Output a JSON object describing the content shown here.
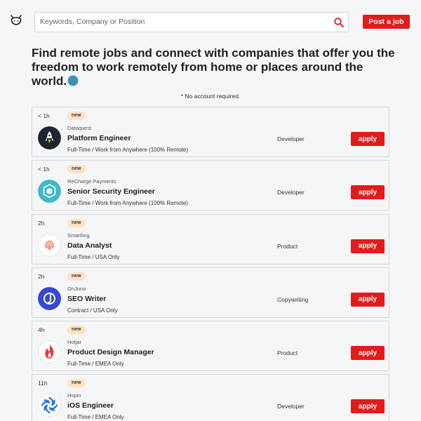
{
  "header": {
    "logo_icon": "cat-logo-icon",
    "search": {
      "placeholder": "Keywords, Company or Position",
      "icon": "search-icon"
    },
    "post_job_label": "Post a job"
  },
  "hero": {
    "headline": "Find remote jobs and connect with companies that offer you the freedom to work remotely from home or places around the world.",
    "globe_icon": "globe-icon",
    "note": "* No account required."
  },
  "colors": {
    "accent": "#e21b1b",
    "badge_bg": "#fbe3c2"
  },
  "jobs": [
    {
      "age": "< 1h",
      "badge": "new",
      "company": "Dataquest",
      "title": "Platform Engineer",
      "type": "Full-Time / Work from Anywhere (100% Remote)",
      "category": "Developer",
      "apply": "apply",
      "logo": "rocket-logo-icon"
    },
    {
      "age": "< 1h",
      "badge": "new",
      "company": "ReCharge Payments",
      "title": "Senior Security Engineer",
      "type": "Full-Time / Work from Anywhere (100% Remote)",
      "category": "Developer",
      "apply": "apply",
      "logo": "recharge-logo-icon"
    },
    {
      "age": "2h",
      "badge": "new",
      "company": "Smartling",
      "title": "Data Analyst",
      "type": "Full-Time / USA Only",
      "category": "Product",
      "apply": "apply",
      "logo": "fingerprint-logo-icon"
    },
    {
      "age": "2h",
      "badge": "new",
      "company": "OnJuno",
      "title": "SEO Writer",
      "type": "Contract / USA Only",
      "category": "Copywriting",
      "apply": "apply",
      "logo": "onjuno-logo-icon"
    },
    {
      "age": "4h",
      "badge": "new",
      "company": "Hotjar",
      "title": "Product Design Manager",
      "type": "Full-Time / EMEA Only",
      "category": "Product",
      "apply": "apply",
      "logo": "flame-logo-icon"
    },
    {
      "age": "11h",
      "badge": "new",
      "company": "Hopin",
      "title": "iOS Engineer",
      "type": "Full-Time / EMEA Only",
      "category": "Developer",
      "apply": "apply",
      "logo": "hopin-logo-icon"
    }
  ]
}
